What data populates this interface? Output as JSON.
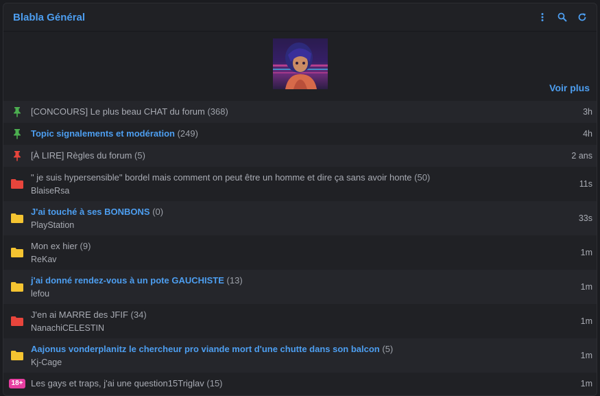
{
  "header": {
    "title": "Blabla Général",
    "actions": [
      {
        "icon": "more-vertical-icon"
      },
      {
        "icon": "search-icon"
      },
      {
        "icon": "refresh-icon"
      }
    ]
  },
  "banner": {
    "voir_plus": "Voir plus"
  },
  "colors": {
    "accent": "#4d9ef0",
    "pin_green": "#4caf50",
    "pin_red": "#e8453c",
    "folder_red": "#e8453c",
    "folder_yellow": "#f5c431",
    "badge_pink": "#e63ea0"
  },
  "topics": [
    {
      "title": "[CONCOURS] Le plus beau CHAT du forum",
      "count": "(368)",
      "author": "",
      "time": "3h",
      "icon": "pin-icon",
      "icon_color": "green",
      "highlight": false
    },
    {
      "title": "Topic signalements et modération",
      "count": "(249)",
      "author": "",
      "time": "4h",
      "icon": "pin-icon",
      "icon_color": "green",
      "highlight": true
    },
    {
      "title": "[À LIRE] Règles du forum",
      "count": "(5)",
      "author": "",
      "time": "2 ans",
      "icon": "pin-icon",
      "icon_color": "red",
      "highlight": false
    },
    {
      "title": "\" je suis hypersensible\" bordel mais comment on peut être un homme et dire ça sans avoir honte",
      "count": "(50)",
      "author": "BlaiseRsa",
      "time": "11s",
      "icon": "folder-icon",
      "icon_color": "red",
      "highlight": false
    },
    {
      "title": "J'ai touché à ses BONBONS",
      "count": "(0)",
      "author": "PlayStation",
      "time": "33s",
      "icon": "folder-icon",
      "icon_color": "yellow",
      "highlight": true
    },
    {
      "title": "Mon ex hier",
      "count": "(9)",
      "author": "ReKav",
      "time": "1m",
      "icon": "folder-icon",
      "icon_color": "yellow",
      "highlight": false
    },
    {
      "title": "j'ai donné rendez-vous à un pote GAUCHISTE",
      "count": "(13)",
      "author": "lefou",
      "time": "1m",
      "icon": "folder-icon",
      "icon_color": "yellow",
      "highlight": true
    },
    {
      "title": "J'en ai MARRE des JFIF",
      "count": "(34)",
      "author": "NanachiCELESTIN",
      "time": "1m",
      "icon": "folder-icon",
      "icon_color": "red",
      "highlight": false
    },
    {
      "title": "Aajonus vonderplanitz le chercheur pro viande mort d'une chutte dans son balcon",
      "count": "(5)",
      "author": "Kj-Cage",
      "time": "1m",
      "icon": "folder-icon",
      "icon_color": "yellow",
      "highlight": true
    },
    {
      "title": "Les gays et traps, j'ai une question15Triglav",
      "count": "(15)",
      "author": "",
      "time": "1m",
      "icon": "nsfw-18-badge",
      "icon_color": "pink",
      "highlight": false,
      "badge": "18+"
    }
  ]
}
